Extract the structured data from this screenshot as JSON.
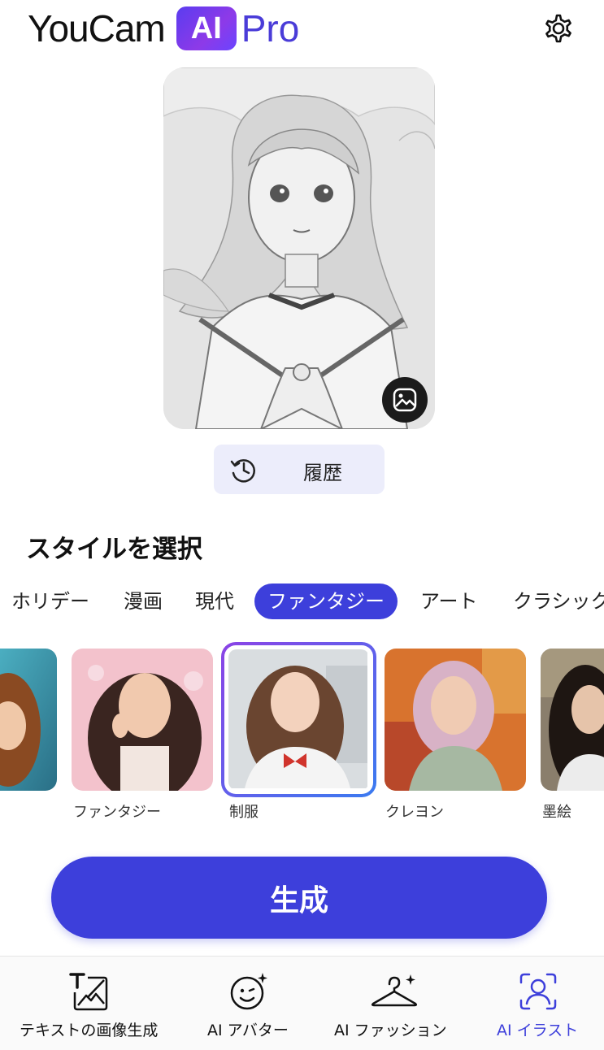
{
  "header": {
    "logo_youcam": "YouCam",
    "logo_ai": "AI",
    "logo_pro": "Pro"
  },
  "preview": {
    "history_label": "履歴"
  },
  "section_title": "スタイルを選択",
  "tabs": [
    {
      "label": "ホリデー",
      "active": false
    },
    {
      "label": "漫画",
      "active": false
    },
    {
      "label": "現代",
      "active": false
    },
    {
      "label": "ファンタジー",
      "active": true
    },
    {
      "label": "アート",
      "active": false
    },
    {
      "label": "クラシック",
      "active": false
    }
  ],
  "styles": [
    {
      "label": "ファンタジー",
      "selected": false
    },
    {
      "label": "制服",
      "selected": true
    },
    {
      "label": "クレヨン",
      "selected": false
    },
    {
      "label": "墨絵",
      "selected": false
    }
  ],
  "generate_label": "生成",
  "bottom_nav": [
    {
      "label": "テキストの画像生成",
      "icon": "text-to-image-icon",
      "active": false
    },
    {
      "label": "AI アバター",
      "icon": "avatar-face-icon",
      "active": false
    },
    {
      "label": "AI ファッション",
      "icon": "hanger-icon",
      "active": false
    },
    {
      "label": "AI イラスト",
      "icon": "illustration-person-icon",
      "active": true
    }
  ],
  "colors": {
    "accent": "#3d3fdb",
    "history_bg": "#ecedfb",
    "logo_gradient_start": "#5a3cf0",
    "logo_gradient_end": "#8d3ae8"
  }
}
